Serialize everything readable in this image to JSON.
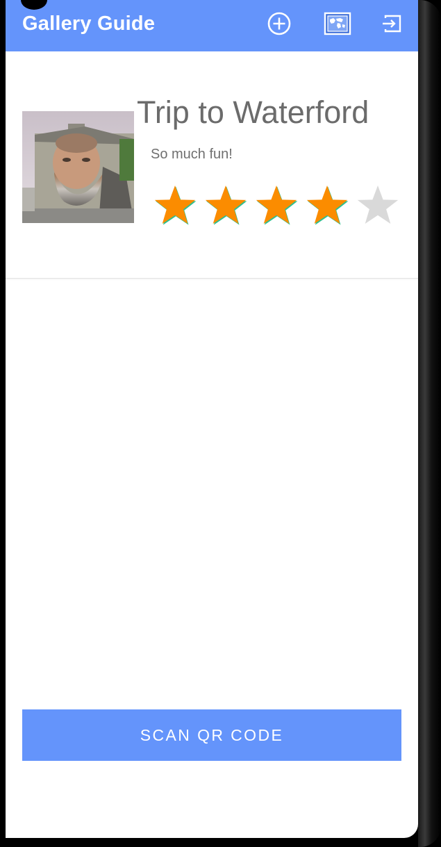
{
  "app_bar": {
    "title": "Gallery Guide",
    "icons": [
      "add-circle-icon",
      "world-map-icon",
      "exit-icon"
    ]
  },
  "card": {
    "title": "Trip to Waterford",
    "description": "So much fun!",
    "rating": 4,
    "max_rating": 5,
    "image_icon": "bearded-man-mural-photo"
  },
  "scan_button": {
    "label": "SCAN QR CODE"
  },
  "colors": {
    "accent": "#6494fb",
    "star_filled": "#fb8c00",
    "star_empty": "#d9d9d9",
    "text_primary": "#6b6b6b"
  }
}
